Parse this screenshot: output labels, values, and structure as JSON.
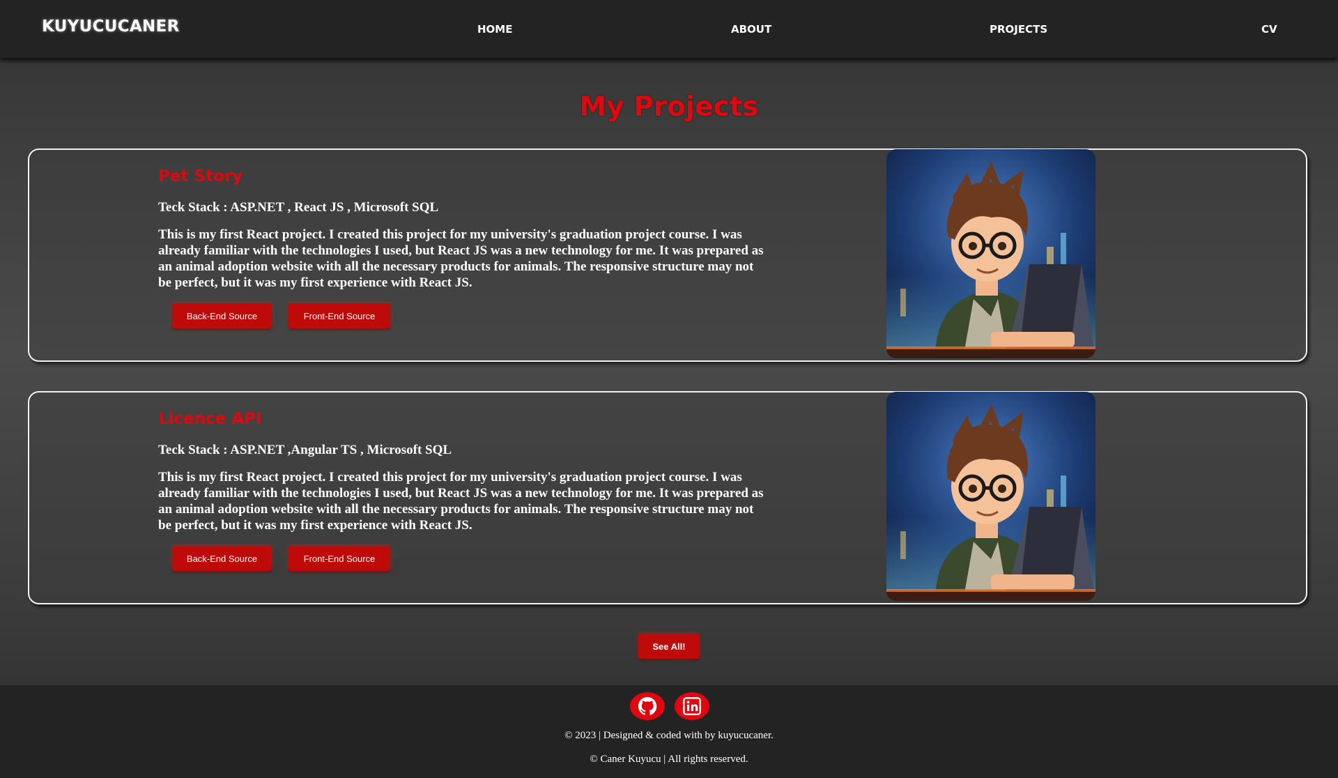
{
  "nav": {
    "brand": "KUYUCUCANER",
    "links": [
      "HOME",
      "ABOUT",
      "PROJECTS",
      "CV"
    ]
  },
  "page": {
    "title": "My Projects"
  },
  "projects": [
    {
      "title": "Pet Story",
      "stack": "Teck Stack : ASP.NET , React JS , Microsoft SQL",
      "description": "This is my first React project. I created this project for my university's graduation project course. I was already familiar with the technologies I used, but React JS was a new technology for me. It was prepared as an animal adoption website with all the necessary products for animals. The responsive structure may not be perfect, but it was my first experience with React JS.",
      "backend_label": "Back-End Source",
      "frontend_label": "Front-End Source"
    },
    {
      "title": "Licence API",
      "stack": "Teck Stack : ASP.NET ,Angular TS , Microsoft SQL",
      "description": "This is my first React project. I created this project for my university's graduation project course. I was already familiar with the technologies I used, but React JS was a new technology for me. It was prepared as an animal adoption website with all the necessary products for animals. The responsive structure may not be perfect, but it was my first experience with React JS.",
      "backend_label": "Back-End Source",
      "frontend_label": "Front-End Source"
    }
  ],
  "see_all_label": "See All!",
  "footer": {
    "icons": [
      "github-icon",
      "linkedin-icon"
    ],
    "line1": "© 2023 | Designed & coded with by kuyucucaner.",
    "line2": "© Caner Kuyucu | All rights reserved."
  },
  "colors": {
    "accent": "#e0070e",
    "button": "#bf0a0a",
    "nav_bg": "#232323"
  }
}
